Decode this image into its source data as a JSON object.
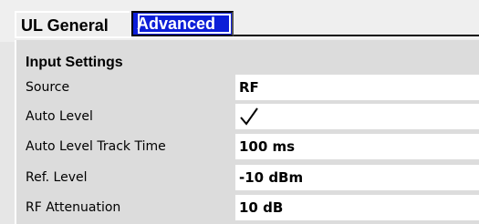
{
  "tabs": [
    {
      "label": "UL General",
      "active": false
    },
    {
      "label": "Advanced",
      "active": true
    }
  ],
  "section": {
    "title": "Input Settings"
  },
  "settings": [
    {
      "label": "Source",
      "value": "RF"
    },
    {
      "label": "Auto Level",
      "value": "",
      "checked": true,
      "icon": "checkmark-icon"
    },
    {
      "label": "Auto Level Track Time",
      "value": "100 ms"
    },
    {
      "label": "Ref. Level",
      "value": "-10 dBm"
    },
    {
      "label": "RF Attenuation",
      "value": "10 dB"
    }
  ],
  "colors": {
    "active_tab_bg": "#0c1ed8",
    "active_tab_text": "#ffffff",
    "panel_bg": "#dcdcdc",
    "field_bg": "#ffffff"
  }
}
